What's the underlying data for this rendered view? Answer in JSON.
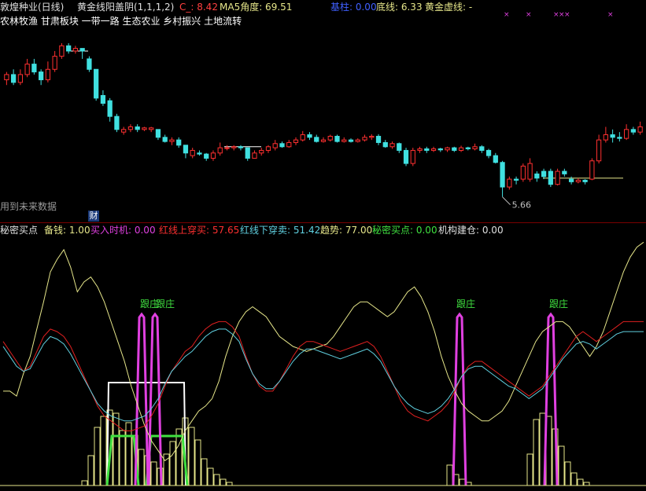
{
  "top_header": {
    "stock": "敦煌种业(日线)",
    "indicator": "黄金线阳盖阴(1,1,1,2)",
    "c_label": "C_: 8.42",
    "ma5_label": "MA5角度: 69.51",
    "jixian_label": "基柱: 0.00",
    "dixian_label": "底线: 6.33",
    "huangjin_label": "黄金虚线: -"
  },
  "concept_tags": "农林牧渔 甘肃板块 一带一路 生态农业 乡村振兴 土地流转",
  "future_note": "用到未来数据",
  "cai_badge": "财",
  "low_price_label": "5.66",
  "bottom_header": {
    "name": "秘密买点",
    "beixian": "备钱: 1.00",
    "mairu": "买入时机: 0.00",
    "hongxian_up": "红线上穿买: 57.65",
    "hongxian_down": "红线下穿卖: 51.42",
    "qushi": "趋势: 77.00",
    "mimi": "秘密买点: 0.00",
    "jigou": "机构建仓: 0.00"
  },
  "signal_labels": [
    "跟庄",
    "跟庄",
    "跟庄",
    "跟庄"
  ],
  "colors": {
    "up": "#ff3030",
    "down": "#40e0e0",
    "yellow": "#e6e68a",
    "red_line": "#e02020",
    "cyan_line": "#60d0e0",
    "magenta": "#e040e0",
    "green": "#40e040",
    "white": "#ffffff"
  },
  "chart_data": [
    {
      "type": "candlestick",
      "title": "敦煌种业(日线)",
      "low_marker": 5.66,
      "candles": [
        {
          "o": 7.9,
          "c": 8.0,
          "h": 8.05,
          "l": 7.8
        },
        {
          "o": 8.0,
          "c": 7.85,
          "h": 8.1,
          "l": 7.8
        },
        {
          "o": 7.85,
          "c": 8.0,
          "h": 8.1,
          "l": 7.8
        },
        {
          "o": 8.0,
          "c": 8.2,
          "h": 8.3,
          "l": 7.95
        },
        {
          "o": 8.2,
          "c": 8.05,
          "h": 8.3,
          "l": 8.0
        },
        {
          "o": 8.05,
          "c": 7.9,
          "h": 8.1,
          "l": 7.8
        },
        {
          "o": 7.9,
          "c": 8.1,
          "h": 8.25,
          "l": 7.85
        },
        {
          "o": 8.1,
          "c": 8.35,
          "h": 8.45,
          "l": 8.05
        },
        {
          "o": 8.35,
          "c": 8.55,
          "h": 8.6,
          "l": 8.3
        },
        {
          "o": 8.55,
          "c": 8.45,
          "h": 8.6,
          "l": 8.4
        },
        {
          "o": 8.45,
          "c": 8.5,
          "h": 8.55,
          "l": 8.4
        },
        {
          "o": 8.5,
          "c": 8.45,
          "h": 8.5,
          "l": 8.3
        },
        {
          "o": 8.3,
          "c": 8.1,
          "h": 8.35,
          "l": 8.05
        },
        {
          "o": 8.1,
          "c": 7.55,
          "h": 8.1,
          "l": 7.5
        },
        {
          "o": 7.6,
          "c": 7.45,
          "h": 7.7,
          "l": 7.4
        },
        {
          "o": 7.5,
          "c": 7.2,
          "h": 7.55,
          "l": 7.1
        },
        {
          "o": 7.2,
          "c": 6.95,
          "h": 7.25,
          "l": 6.9
        },
        {
          "o": 6.9,
          "c": 6.95,
          "h": 7.0,
          "l": 6.85
        },
        {
          "o": 6.95,
          "c": 7.0,
          "h": 7.05,
          "l": 6.9
        },
        {
          "o": 7.0,
          "c": 6.95,
          "h": 7.05,
          "l": 6.9
        },
        {
          "o": 6.95,
          "c": 6.98,
          "h": 7.0,
          "l": 6.92
        },
        {
          "o": 6.95,
          "c": 6.98,
          "h": 7.0,
          "l": 6.9
        },
        {
          "o": 6.95,
          "c": 6.8,
          "h": 6.95,
          "l": 6.75
        },
        {
          "o": 6.8,
          "c": 6.72,
          "h": 6.85,
          "l": 6.7
        },
        {
          "o": 6.72,
          "c": 6.75,
          "h": 6.8,
          "l": 6.65
        },
        {
          "o": 6.75,
          "c": 6.65,
          "h": 6.8,
          "l": 6.6
        },
        {
          "o": 6.65,
          "c": 6.5,
          "h": 6.65,
          "l": 6.4
        },
        {
          "o": 6.45,
          "c": 6.55,
          "h": 6.6,
          "l": 6.4
        },
        {
          "o": 6.5,
          "c": 6.48,
          "h": 6.55,
          "l": 6.45
        },
        {
          "o": 6.48,
          "c": 6.4,
          "h": 6.5,
          "l": 6.35
        },
        {
          "o": 6.4,
          "c": 6.5,
          "h": 6.55,
          "l": 6.35
        },
        {
          "o": 6.5,
          "c": 6.6,
          "h": 6.7,
          "l": 6.45
        },
        {
          "o": 6.6,
          "c": 6.6,
          "h": 6.65,
          "l": 6.55
        },
        {
          "o": 6.6,
          "c": 6.62,
          "h": 6.65,
          "l": 6.55
        },
        {
          "o": 6.62,
          "c": 6.6,
          "h": 6.65,
          "l": 6.55
        },
        {
          "o": 6.6,
          "c": 6.4,
          "h": 6.6,
          "l": 6.35
        },
        {
          "o": 6.4,
          "c": 6.5,
          "h": 6.55,
          "l": 6.4
        },
        {
          "o": 6.5,
          "c": 6.55,
          "h": 6.6,
          "l": 6.45
        },
        {
          "o": 6.55,
          "c": 6.62,
          "h": 6.65,
          "l": 6.5
        },
        {
          "o": 6.6,
          "c": 6.68,
          "h": 6.75,
          "l": 6.55
        },
        {
          "o": 6.68,
          "c": 6.62,
          "h": 6.72,
          "l": 6.6
        },
        {
          "o": 6.62,
          "c": 6.7,
          "h": 6.75,
          "l": 6.6
        },
        {
          "o": 6.7,
          "c": 6.75,
          "h": 6.8,
          "l": 6.65
        },
        {
          "o": 6.75,
          "c": 6.85,
          "h": 6.92,
          "l": 6.72
        },
        {
          "o": 6.85,
          "c": 6.8,
          "h": 6.9,
          "l": 6.75
        },
        {
          "o": 6.8,
          "c": 6.72,
          "h": 6.85,
          "l": 6.7
        },
        {
          "o": 6.72,
          "c": 6.75,
          "h": 6.8,
          "l": 6.7
        },
        {
          "o": 6.75,
          "c": 6.82,
          "h": 6.85,
          "l": 6.72
        },
        {
          "o": 6.82,
          "c": 6.72,
          "h": 6.85,
          "l": 6.7
        },
        {
          "o": 6.72,
          "c": 6.75,
          "h": 6.8,
          "l": 6.7
        },
        {
          "o": 6.75,
          "c": 6.72,
          "h": 6.78,
          "l": 6.7
        },
        {
          "o": 6.72,
          "c": 6.75,
          "h": 6.78,
          "l": 6.7
        },
        {
          "o": 6.75,
          "c": 6.8,
          "h": 6.85,
          "l": 6.72
        },
        {
          "o": 6.8,
          "c": 6.82,
          "h": 6.86,
          "l": 6.75
        },
        {
          "o": 6.82,
          "c": 6.7,
          "h": 6.86,
          "l": 6.65
        },
        {
          "o": 6.7,
          "c": 6.62,
          "h": 6.75,
          "l": 6.6
        },
        {
          "o": 6.62,
          "c": 6.68,
          "h": 6.72,
          "l": 6.58
        },
        {
          "o": 6.68,
          "c": 6.55,
          "h": 6.7,
          "l": 6.5
        },
        {
          "o": 6.55,
          "c": 6.3,
          "h": 6.6,
          "l": 6.25
        },
        {
          "o": 6.3,
          "c": 6.55,
          "h": 6.6,
          "l": 6.25
        },
        {
          "o": 6.55,
          "c": 6.58,
          "h": 6.62,
          "l": 6.5
        },
        {
          "o": 6.58,
          "c": 6.55,
          "h": 6.62,
          "l": 6.5
        },
        {
          "o": 6.55,
          "c": 6.58,
          "h": 6.62,
          "l": 6.52
        },
        {
          "o": 6.58,
          "c": 6.56,
          "h": 6.6,
          "l": 6.52
        },
        {
          "o": 6.56,
          "c": 6.6,
          "h": 6.62,
          "l": 6.52
        },
        {
          "o": 6.6,
          "c": 6.55,
          "h": 6.62,
          "l": 6.52
        },
        {
          "o": 6.55,
          "c": 6.6,
          "h": 6.64,
          "l": 6.52
        },
        {
          "o": 6.6,
          "c": 6.58,
          "h": 6.62,
          "l": 6.55
        },
        {
          "o": 6.58,
          "c": 6.62,
          "h": 6.68,
          "l": 6.55
        },
        {
          "o": 6.62,
          "c": 6.55,
          "h": 6.65,
          "l": 6.5
        },
        {
          "o": 6.55,
          "c": 6.45,
          "h": 6.58,
          "l": 6.4
        },
        {
          "o": 6.45,
          "c": 6.32,
          "h": 6.5,
          "l": 6.3
        },
        {
          "o": 6.32,
          "c": 5.85,
          "h": 6.35,
          "l": 5.66
        },
        {
          "o": 5.85,
          "c": 6.0,
          "h": 6.05,
          "l": 5.8
        },
        {
          "o": 6.0,
          "c": 5.98,
          "h": 6.05,
          "l": 5.9
        },
        {
          "o": 6.0,
          "c": 6.25,
          "h": 6.3,
          "l": 5.95
        },
        {
          "o": 6.0,
          "c": 6.3,
          "h": 6.4,
          "l": 5.95
        },
        {
          "o": 6.1,
          "c": 6.02,
          "h": 6.15,
          "l": 5.95
        },
        {
          "o": 6.15,
          "c": 6.05,
          "h": 6.2,
          "l": 6.0
        },
        {
          "o": 6.15,
          "c": 5.9,
          "h": 6.2,
          "l": 5.85
        },
        {
          "o": 5.9,
          "c": 6.15,
          "h": 6.2,
          "l": 5.88
        },
        {
          "o": 6.15,
          "c": 6.1,
          "h": 6.2,
          "l": 6.05
        },
        {
          "o": 6.0,
          "c": 5.95,
          "h": 6.05,
          "l": 5.9
        },
        {
          "o": 5.95,
          "c": 5.98,
          "h": 6.02,
          "l": 5.92
        },
        {
          "o": 5.98,
          "c": 5.95,
          "h": 6.0,
          "l": 5.9
        },
        {
          "o": 6.0,
          "c": 6.35,
          "h": 6.4,
          "l": 5.98
        },
        {
          "o": 6.35,
          "c": 6.75,
          "h": 6.85,
          "l": 6.3
        },
        {
          "o": 6.75,
          "c": 6.85,
          "h": 7.0,
          "l": 6.7
        },
        {
          "o": 6.85,
          "c": 6.8,
          "h": 6.95,
          "l": 6.7
        },
        {
          "o": 6.8,
          "c": 6.78,
          "h": 6.9,
          "l": 6.72
        },
        {
          "o": 6.78,
          "c": 6.95,
          "h": 7.05,
          "l": 6.75
        },
        {
          "o": 6.95,
          "c": 6.9,
          "h": 7.0,
          "l": 6.85
        },
        {
          "o": 6.9,
          "c": 7.0,
          "h": 7.1,
          "l": 6.85
        }
      ]
    },
    {
      "type": "line",
      "title": "秘密买点",
      "ylim": [
        0,
        100
      ],
      "series": [
        {
          "name": "趋势",
          "values": [
            38,
            38,
            36,
            45,
            52,
            63,
            74,
            86,
            91,
            95,
            88,
            78,
            82,
            84,
            80,
            74,
            66,
            58,
            50,
            40,
            32,
            24,
            18,
            14,
            10,
            12,
            16,
            22,
            26,
            30,
            32,
            35,
            42,
            52,
            60,
            66,
            70,
            72,
            70,
            68,
            64,
            60,
            58,
            56,
            55,
            54,
            55,
            56,
            57,
            60,
            64,
            68,
            72,
            74,
            74,
            72,
            70,
            68,
            70,
            74,
            78,
            80,
            76,
            70,
            62,
            52,
            44,
            38,
            33,
            30,
            28,
            26,
            26,
            28,
            30,
            34,
            40,
            46,
            52,
            58,
            62,
            64,
            66,
            66,
            64,
            60,
            56,
            52,
            56,
            62,
            70,
            78,
            86,
            92,
            96,
            98
          ]
        },
        {
          "name": "红线上穿买",
          "values": [
            58,
            54,
            50,
            46,
            48,
            54,
            60,
            63,
            62,
            60,
            56,
            50,
            44,
            38,
            32,
            28,
            26,
            24,
            22,
            22,
            23,
            24,
            28,
            33,
            40,
            46,
            50,
            54,
            56,
            60,
            63,
            65,
            66,
            66,
            64,
            60,
            52,
            45,
            40,
            38,
            38,
            42,
            47,
            52,
            56,
            58,
            58,
            57,
            56,
            55,
            54,
            55,
            56,
            57,
            58,
            56,
            52,
            46,
            40,
            34,
            30,
            28,
            27,
            26,
            28,
            30,
            33,
            38,
            44,
            48,
            50,
            50,
            48,
            46,
            44,
            42,
            40,
            38,
            36,
            38,
            40,
            44,
            48,
            52,
            56,
            60,
            62,
            60,
            58,
            60,
            62,
            64,
            66,
            66,
            66,
            66
          ]
        },
        {
          "name": "红线下穿卖",
          "values": [
            56,
            52,
            48,
            46,
            47,
            52,
            57,
            60,
            59,
            57,
            53,
            48,
            43,
            38,
            33,
            30,
            28,
            27,
            26,
            26,
            27,
            28,
            31,
            35,
            41,
            46,
            49,
            52,
            54,
            57,
            60,
            62,
            63,
            63,
            61,
            58,
            51,
            45,
            41,
            39,
            39,
            42,
            46,
            50,
            53,
            55,
            55,
            54,
            53,
            52,
            51,
            52,
            53,
            54,
            55,
            53,
            50,
            45,
            40,
            36,
            33,
            31,
            30,
            29,
            30,
            32,
            35,
            39,
            44,
            47,
            48,
            48,
            46,
            44,
            42,
            40,
            39,
            37,
            35,
            37,
            39,
            43,
            47,
            51,
            54,
            57,
            58,
            57,
            55,
            57,
            59,
            61,
            62,
            62,
            62,
            62
          ]
        }
      ]
    }
  ]
}
